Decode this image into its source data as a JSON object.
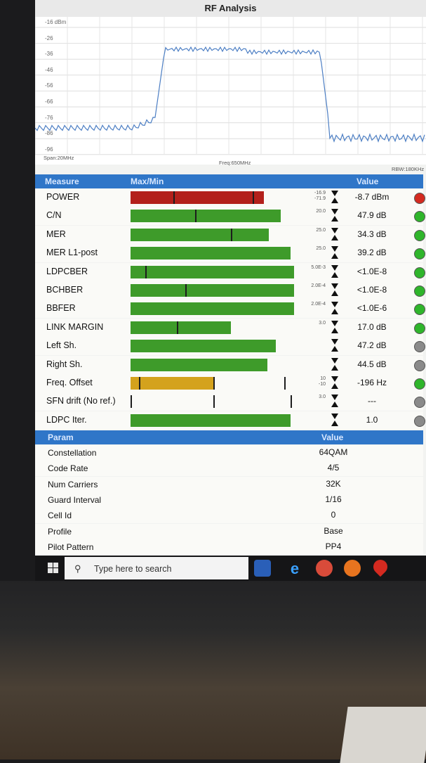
{
  "window": {
    "title": "RF Analysis"
  },
  "spectrum": {
    "y_labels": [
      "-16 dBm",
      "-26",
      "-36",
      "-46",
      "-56",
      "-66",
      "-76",
      "-86",
      "-96"
    ],
    "span": "Span:20MHz",
    "freq": "Freq:650MHz",
    "rbw": "RBW:180KHz"
  },
  "measure_header": {
    "measure": "Measure",
    "maxmin": "Max/Min",
    "value": "Value"
  },
  "measures": [
    {
      "name": "POWER",
      "fill": 0.81,
      "color": "#b3201b",
      "marks": [
        0.26,
        0.74
      ],
      "scale": [
        "-16.9",
        "-71.9"
      ],
      "value": "-8.7 dBm",
      "led": "#d42a20"
    },
    {
      "name": "C/N",
      "fill": 0.91,
      "color": "#3e9b2a",
      "marks": [
        0.39
      ],
      "scale": [
        "20.0"
      ],
      "value": "47.9 dB",
      "led": "#2fb52b"
    },
    {
      "name": "MER",
      "fill": 0.84,
      "color": "#3e9b2a",
      "marks": [
        0.61
      ],
      "scale": [
        "25.0"
      ],
      "value": "34.3 dB",
      "led": "#2fb52b"
    },
    {
      "name": "MER L1-post",
      "fill": 0.97,
      "color": "#3e9b2a",
      "marks": [],
      "scale": [
        "25.0"
      ],
      "value": "39.2 dB",
      "led": "#2fb52b"
    },
    {
      "name": "LDPCBER",
      "fill": 0.99,
      "color": "#3e9b2a",
      "marks": [
        0.09
      ],
      "scale": [
        "5.0E-3"
      ],
      "value": "<1.0E-8",
      "led": "#2fb52b"
    },
    {
      "name": "BCHBER",
      "fill": 0.99,
      "color": "#3e9b2a",
      "marks": [
        0.33
      ],
      "scale": [
        "2.0E-4"
      ],
      "value": "<1.0E-8",
      "led": "#2fb52b"
    },
    {
      "name": "BBFER",
      "fill": 0.99,
      "color": "#3e9b2a",
      "marks": [],
      "scale": [
        "2.0E-4"
      ],
      "value": "<1.0E-6",
      "led": "#2fb52b"
    },
    {
      "name": "LINK MARGIN",
      "fill": 0.61,
      "color": "#3e9b2a",
      "marks": [
        0.28
      ],
      "scale": [
        "3.0"
      ],
      "value": "17.0 dB",
      "led": "#2fb52b"
    },
    {
      "name": "Left Sh.",
      "fill": 0.88,
      "color": "#3e9b2a",
      "marks": [],
      "scale": [],
      "value": "47.2 dB",
      "led": "#8a8a8a"
    },
    {
      "name": "Right Sh.",
      "fill": 0.83,
      "color": "#3e9b2a",
      "marks": [],
      "scale": [],
      "value": "44.5 dB",
      "led": "#8a8a8a"
    },
    {
      "name": "Freq. Offset",
      "fill": 0.5,
      "color": "#d4a21d",
      "marks": [
        0.05,
        0.5,
        0.93
      ],
      "scale": [
        "10",
        "-10"
      ],
      "value": "-196 Hz",
      "led": "#2fb52b"
    },
    {
      "name": "SFN drift (No ref.)",
      "fill": 0,
      "color": "#3e9b2a",
      "marks": [
        0.0,
        0.5,
        0.97
      ],
      "scale": [
        "3.0"
      ],
      "value": "---",
      "led": "#8a8a8a"
    },
    {
      "name": "LDPC Iter.",
      "fill": 0.97,
      "color": "#3e9b2a",
      "marks": [],
      "scale": [],
      "value": "1.0",
      "led": "#8a8a8a"
    }
  ],
  "param_header": {
    "param": "Param",
    "value": "Value"
  },
  "params": [
    {
      "name": "Constellation",
      "value": "64QAM"
    },
    {
      "name": "Code Rate",
      "value": "4/5"
    },
    {
      "name": "Num Carriers",
      "value": "32K"
    },
    {
      "name": "Guard Interval",
      "value": "1/16"
    },
    {
      "name": "Cell Id",
      "value": "0"
    },
    {
      "name": "Profile",
      "value": "Base"
    },
    {
      "name": "Pilot Pattern",
      "value": "PP4"
    }
  ],
  "taskbar": {
    "search_placeholder": "Type here to search",
    "icons": [
      "store-icon",
      "edge-icon",
      "chrome-icon",
      "firefox-icon",
      "maps-icon"
    ]
  }
}
